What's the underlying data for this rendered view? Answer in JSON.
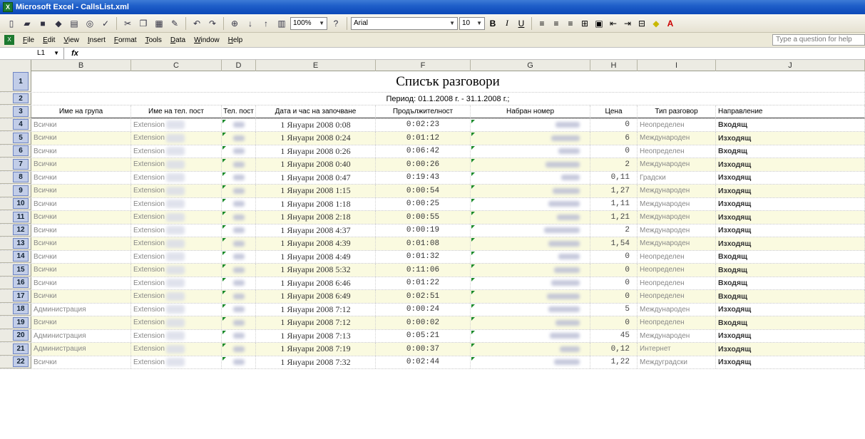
{
  "window": {
    "title": "Microsoft Excel - CallsList.xml",
    "app_icon": "excel-icon"
  },
  "toolbar": {
    "zoom": "100%",
    "font_name": "Arial",
    "font_size": "10",
    "bold_label": "B",
    "italic_label": "I",
    "underline_label": "U"
  },
  "menu": {
    "items": [
      "File",
      "Edit",
      "View",
      "Insert",
      "Format",
      "Tools",
      "Data",
      "Window",
      "Help"
    ],
    "question_placeholder": "Type a question for help"
  },
  "formula_bar": {
    "name_box": "L1",
    "fx_label": "fx",
    "formula": ""
  },
  "columns": [
    "B",
    "C",
    "D",
    "E",
    "F",
    "G",
    "H",
    "I",
    "J"
  ],
  "sheet": {
    "title": "Списък разговори",
    "period": "Период: 01.1.2008 г. - 31.1.2008 г.;",
    "headers": [
      "Име на група",
      "Име на тел. пост",
      "Тел. пост",
      "Дата и час на започване",
      "Продължителност",
      "Набран номер",
      "Цена",
      "Тип разговор",
      "Направление"
    ],
    "rows": [
      {
        "n": "4",
        "group": "Всички",
        "ext": "Extension",
        "date": "1 Януари 2008 0:08",
        "dur": "0:02:23",
        "price": "0",
        "type": "Неопределен",
        "dir": "Входящ"
      },
      {
        "n": "5",
        "group": "Всички",
        "ext": "Extension",
        "date": "1 Януари 2008 0:24",
        "dur": "0:01:12",
        "price": "6",
        "type": "Международен",
        "dir": "Изходящ"
      },
      {
        "n": "6",
        "group": "Всички",
        "ext": "Extension",
        "date": "1 Януари 2008 0:26",
        "dur": "0:06:42",
        "price": "0",
        "type": "Неопределен",
        "dir": "Входящ"
      },
      {
        "n": "7",
        "group": "Всички",
        "ext": "Extension",
        "date": "1 Януари 2008 0:40",
        "dur": "0:00:26",
        "price": "2",
        "type": "Международен",
        "dir": "Изходящ"
      },
      {
        "n": "8",
        "group": "Всички",
        "ext": "Extension",
        "date": "1 Януари 2008 0:47",
        "dur": "0:19:43",
        "price": "0,11",
        "type": "Градски",
        "dir": "Изходящ"
      },
      {
        "n": "9",
        "group": "Всички",
        "ext": "Extension",
        "date": "1 Януари 2008 1:15",
        "dur": "0:00:54",
        "price": "1,27",
        "type": "Международен",
        "dir": "Изходящ"
      },
      {
        "n": "10",
        "group": "Всички",
        "ext": "Extension",
        "date": "1 Януари 2008 1:18",
        "dur": "0:00:25",
        "price": "1,11",
        "type": "Международен",
        "dir": "Изходящ"
      },
      {
        "n": "11",
        "group": "Всички",
        "ext": "Extension",
        "date": "1 Януари 2008 2:18",
        "dur": "0:00:55",
        "price": "1,21",
        "type": "Международен",
        "dir": "Изходящ"
      },
      {
        "n": "12",
        "group": "Всички",
        "ext": "Extension",
        "date": "1 Януари 2008 4:37",
        "dur": "0:00:19",
        "price": "2",
        "type": "Международен",
        "dir": "Изходящ"
      },
      {
        "n": "13",
        "group": "Всички",
        "ext": "Extension",
        "date": "1 Януари 2008 4:39",
        "dur": "0:01:08",
        "price": "1,54",
        "type": "Международен",
        "dir": "Изходящ"
      },
      {
        "n": "14",
        "group": "Всички",
        "ext": "Extension",
        "date": "1 Януари 2008 4:49",
        "dur": "0:01:32",
        "price": "0",
        "type": "Неопределен",
        "dir": "Входящ"
      },
      {
        "n": "15",
        "group": "Всички",
        "ext": "Extension",
        "date": "1 Януари 2008 5:32",
        "dur": "0:11:06",
        "price": "0",
        "type": "Неопределен",
        "dir": "Входящ"
      },
      {
        "n": "16",
        "group": "Всички",
        "ext": "Extension",
        "date": "1 Януари 2008 6:46",
        "dur": "0:01:22",
        "price": "0",
        "type": "Неопределен",
        "dir": "Входящ"
      },
      {
        "n": "17",
        "group": "Всички",
        "ext": "Extension",
        "date": "1 Януари 2008 6:49",
        "dur": "0:02:51",
        "price": "0",
        "type": "Неопределен",
        "dir": "Входящ"
      },
      {
        "n": "18",
        "group": "Администрация",
        "ext": "Extension",
        "date": "1 Януари 2008 7:12",
        "dur": "0:00:24",
        "price": "5",
        "type": "Международен",
        "dir": "Изходящ"
      },
      {
        "n": "19",
        "group": "Всички",
        "ext": "Extension",
        "date": "1 Януари 2008 7:12",
        "dur": "0:00:02",
        "price": "0",
        "type": "Неопределен",
        "dir": "Входящ"
      },
      {
        "n": "20",
        "group": "Администрация",
        "ext": "Extension",
        "date": "1 Януари 2008 7:13",
        "dur": "0:05:21",
        "price": "45",
        "type": "Международен",
        "dir": "Изходящ"
      },
      {
        "n": "21",
        "group": "Администрация",
        "ext": "Extension",
        "date": "1 Януари 2008 7:19",
        "dur": "0:00:37",
        "price": "0,12",
        "type": "Интернет",
        "dir": "Изходящ"
      },
      {
        "n": "22",
        "group": "Всички",
        "ext": "Extension",
        "date": "1 Януари 2008 7:32",
        "dur": "0:02:44",
        "price": "1,22",
        "type": "Междуградски",
        "dir": "Изходящ"
      }
    ]
  }
}
